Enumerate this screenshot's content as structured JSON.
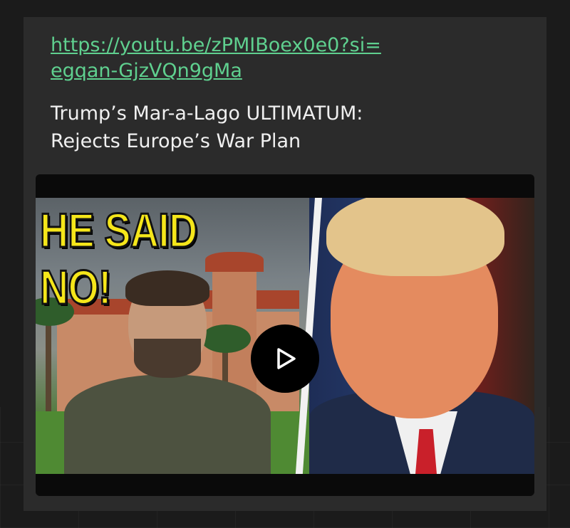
{
  "post": {
    "link_line1": "https://youtu.be/zPMIBoex0e0?si=",
    "link_line2": "egqan-GjzVQn9gMa",
    "title_line1": "Trump’s Mar-a-Lago ULTIMATUM:",
    "title_line2": "Rejects Europe’s War Plan"
  },
  "thumbnail": {
    "headline": "HE SAID NO!"
  },
  "player": {
    "play_icon": "play-icon"
  },
  "colors": {
    "link": "#5fd08f",
    "headline": "#f5e61a",
    "card_bg": "#2b2b2b"
  }
}
